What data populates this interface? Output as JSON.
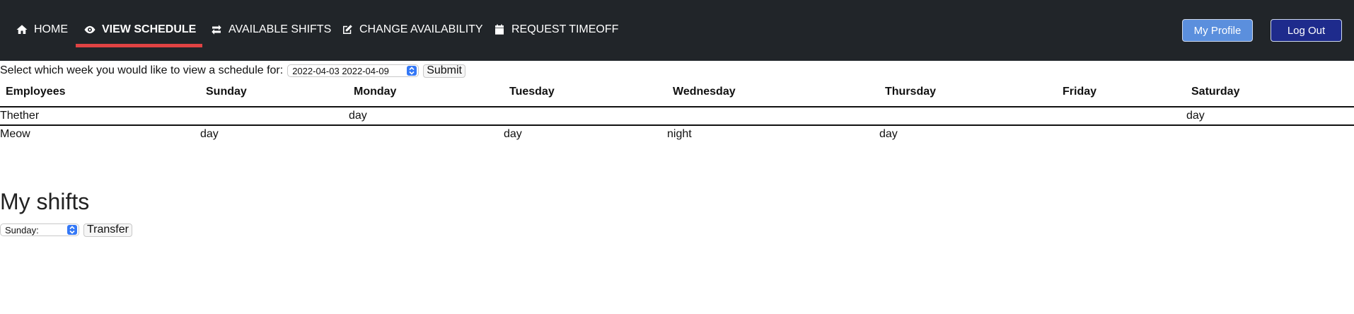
{
  "nav": {
    "items": [
      {
        "label": "HOME",
        "icon": "home-icon"
      },
      {
        "label": "VIEW SCHEDULE",
        "icon": "eye-icon"
      },
      {
        "label": "AVAILABLE SHIFTS",
        "icon": "swap-arrows-icon"
      },
      {
        "label": "CHANGE AVAILABILITY",
        "icon": "edit-icon"
      },
      {
        "label": "REQUEST TIMEOFF",
        "icon": "calendar-icon"
      }
    ],
    "active": "VIEW SCHEDULE",
    "profile_label": "My Profile",
    "logout_label": "Log Out"
  },
  "week_select": {
    "prompt": "Select which week you would like to view a schedule for:",
    "selected": "2022-04-03 2022-04-09",
    "submit_label": "Submit"
  },
  "schedule": {
    "columns": [
      "Employees",
      "Sunday",
      "Monday",
      "Tuesday",
      "Wednesday",
      "Thursday",
      "Friday",
      "Saturday"
    ],
    "rows": [
      {
        "employee": "Thether",
        "Sunday": "",
        "Monday": "day",
        "Tuesday": "",
        "Wednesday": "",
        "Thursday": "",
        "Friday": "",
        "Saturday": "day"
      },
      {
        "employee": "Meow",
        "Sunday": "day",
        "Monday": "",
        "Tuesday": "day",
        "Wednesday": "night",
        "Thursday": "day",
        "Friday": "",
        "Saturday": ""
      }
    ]
  },
  "my_shifts": {
    "title": "My shifts",
    "selected": "Sunday:",
    "transfer_label": "Transfer"
  },
  "colors": {
    "navbar_bg": "#212529",
    "active_underline": "#e04343",
    "profile_button": "#5b8fdd",
    "logout_button": "#1e2b8c",
    "select_accent": "#3478f6"
  }
}
